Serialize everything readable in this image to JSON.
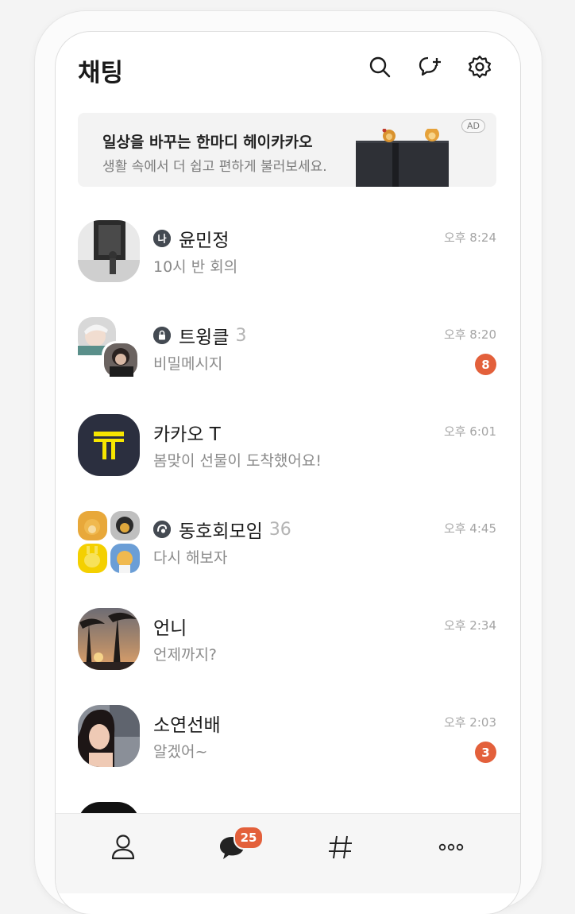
{
  "header": {
    "title": "채팅",
    "icons": [
      "search-icon",
      "new-chat-icon",
      "settings-icon"
    ]
  },
  "ad": {
    "title": "일상을 바꾸는 한마디 헤이카카오",
    "subtitle": "생활 속에서 더 쉽고 편하게 불러보세요.",
    "badge": "AD"
  },
  "chats": [
    {
      "name": "윤민정",
      "badge_icon": "me-icon",
      "badge_icon_text": "나",
      "count": "",
      "preview": "10시 반 회의",
      "time": "오후 8:24",
      "unread": ""
    },
    {
      "name": "트윙클",
      "badge_icon": "lock-icon",
      "count": "3",
      "preview": "비밀메시지",
      "time": "오후 8:20",
      "unread": "8"
    },
    {
      "name": "카카오 T",
      "badge_icon": "",
      "count": "",
      "preview": "봄맞이 선물이 도착했어요!",
      "time": "오후 6:01",
      "unread": ""
    },
    {
      "name": "동호회모임",
      "badge_icon": "open-chat-icon",
      "count": "36",
      "preview": "다시 해보자",
      "time": "오후 4:45",
      "unread": ""
    },
    {
      "name": "언니",
      "badge_icon": "",
      "count": "",
      "preview": "언제까지?",
      "time": "오후 2:34",
      "unread": ""
    },
    {
      "name": "소연선배",
      "badge_icon": "",
      "count": "",
      "preview": "알겠어~",
      "time": "오후 2:03",
      "unread": "3"
    }
  ],
  "tabbar": {
    "tabs": [
      "friends-tab",
      "chats-tab",
      "openchat-tab",
      "more-tab"
    ],
    "chats_badge": "25"
  },
  "colors": {
    "badge": "#e3603b",
    "kakao_yellow": "#f7e600",
    "kakao_t_bg": "#2b2f3f"
  }
}
